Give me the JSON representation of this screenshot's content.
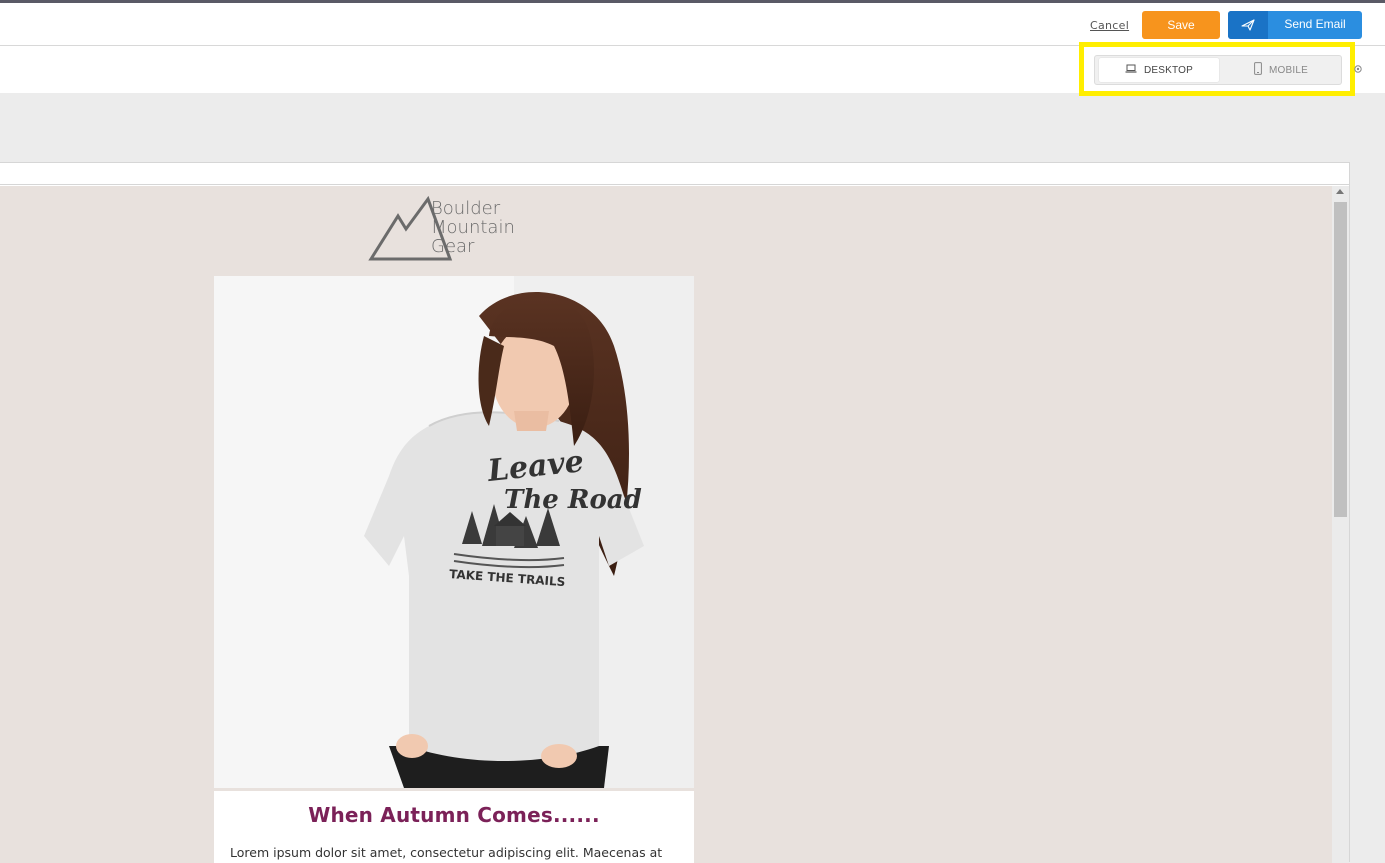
{
  "header": {
    "cancel_label": "Cancel",
    "save_label": "Save",
    "send_label": "Send Email"
  },
  "view_toggle": {
    "desktop_label": "DESKTOP",
    "mobile_label": "MOBILE",
    "selected": "DESKTOP"
  },
  "email": {
    "logo_lines": [
      "Boulder",
      "Mountain",
      "Gear"
    ],
    "hero_shirt_text": [
      "Leave",
      "The Road",
      "TAKE THE TRAILS"
    ],
    "card_title": "When Autumn Comes......",
    "card_body": "Lorem ipsum dolor sit amet, consectetur adipiscing elit. Maecenas at"
  },
  "colors": {
    "save": "#f7941d",
    "send": "#2b8ee0",
    "highlight": "#ffee00",
    "email_bg": "#e8e1dd",
    "title": "#7b2158"
  },
  "icons": {
    "send": "paper-plane-icon",
    "desktop": "laptop-icon",
    "mobile": "phone-icon",
    "settings": "gear-icon"
  }
}
